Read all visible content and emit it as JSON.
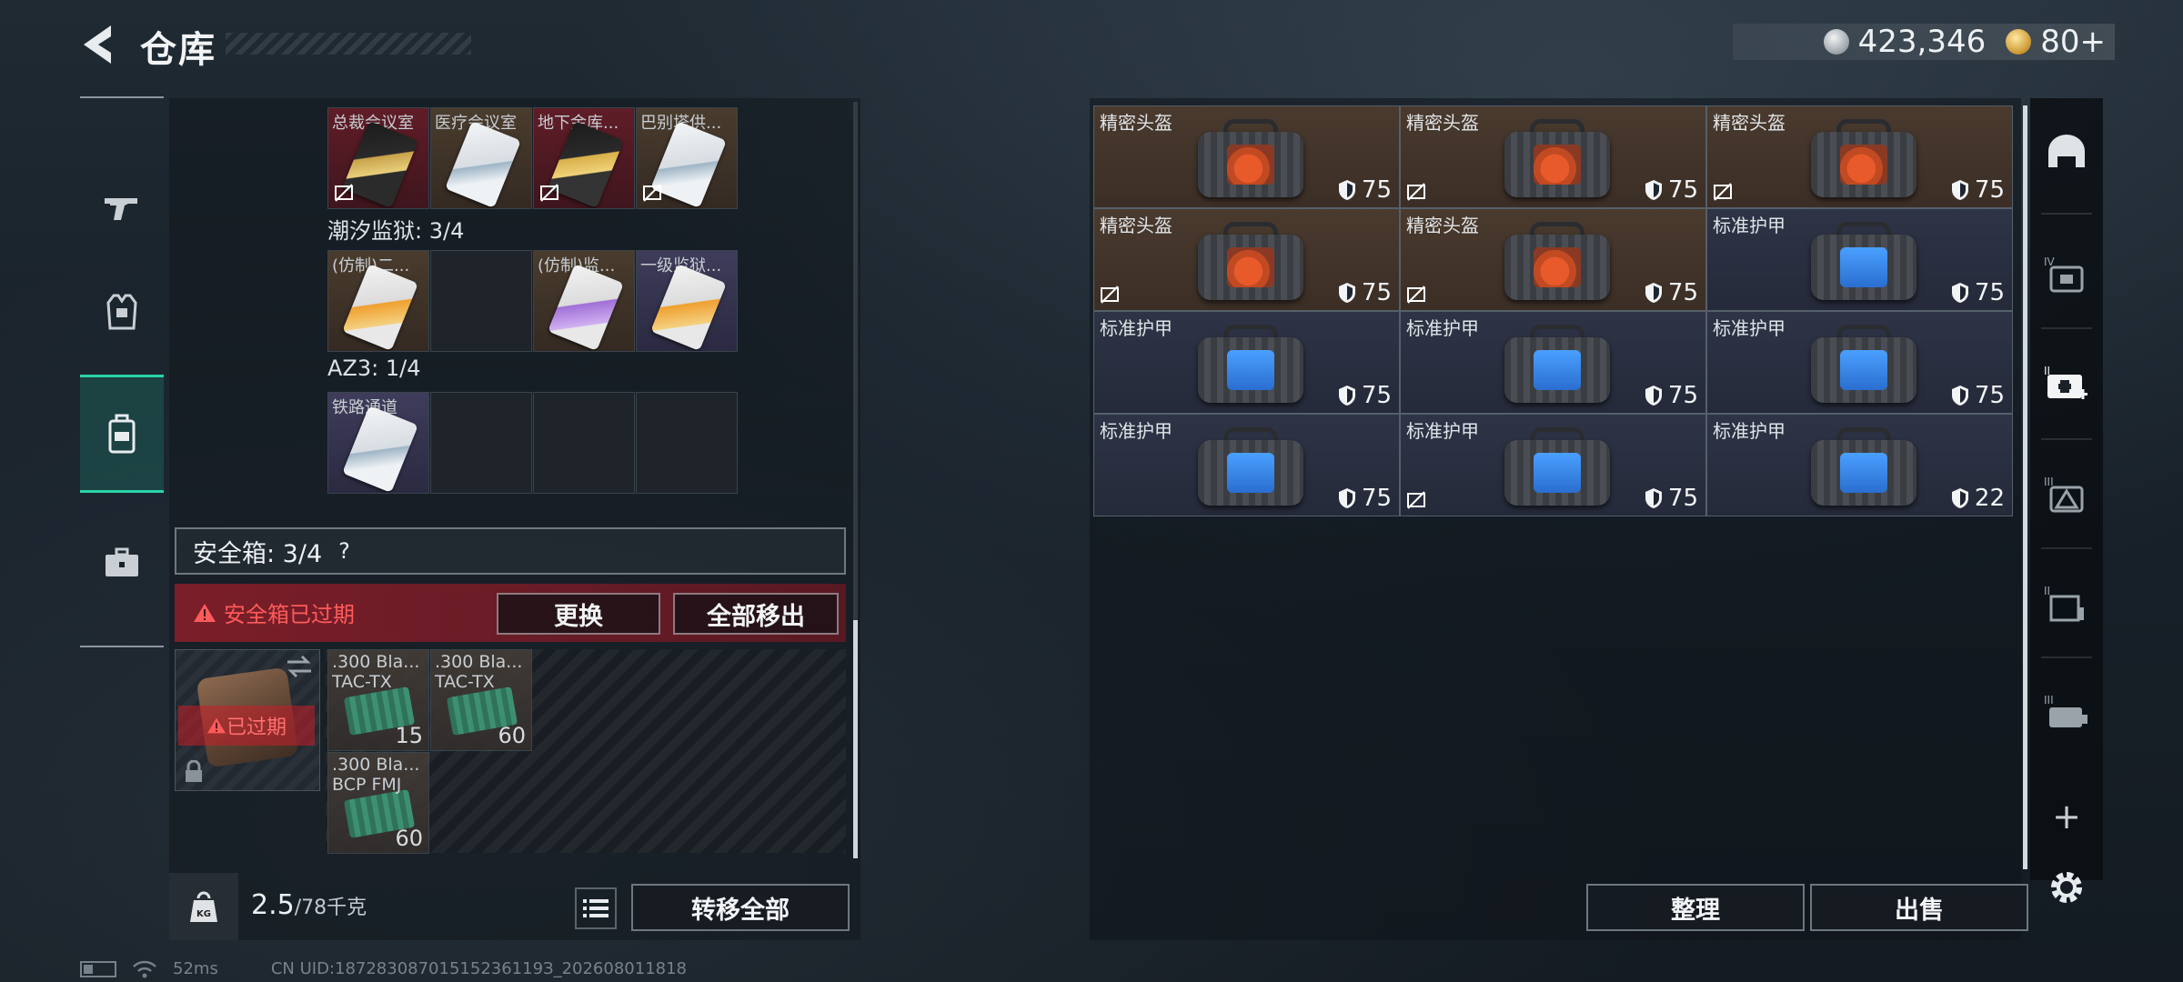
{
  "header": {
    "title": "仓库",
    "currency": [
      {
        "name": "silver-coin",
        "value": "423,346"
      },
      {
        "name": "gold-coin",
        "value": "80+"
      }
    ]
  },
  "left_nav": {
    "items": [
      {
        "icon": "gun-icon",
        "active": false
      },
      {
        "icon": "armor-vest-icon",
        "active": false
      },
      {
        "icon": "backpack-icon",
        "active": true
      },
      {
        "icon": "briefcase-icon",
        "active": false
      }
    ]
  },
  "keycards": {
    "row1": [
      {
        "label": "总裁会议室",
        "color": "red",
        "card": "gold",
        "unusable": true
      },
      {
        "label": "医疗会议室",
        "color": "brown",
        "card": "white",
        "unusable": false
      },
      {
        "label": "地下金库...",
        "color": "red",
        "card": "gold2",
        "unusable": true
      },
      {
        "label": "巴别塔供...",
        "color": "brown",
        "card": "white",
        "unusable": true
      }
    ],
    "section2": "潮汐监狱: 3/4",
    "row2": [
      {
        "label": "(仿制)二...",
        "color": "brown",
        "card": "orange"
      },
      {
        "label": "",
        "color": "empty",
        "card": ""
      },
      {
        "label": "(仿制)监...",
        "color": "brown",
        "card": "violet"
      },
      {
        "label": "一级监狱...",
        "color": "purple",
        "card": "orange"
      }
    ],
    "section3": "AZ3: 1/4",
    "row3": [
      {
        "label": "铁路通道",
        "color": "purple",
        "card": "white"
      },
      {
        "label": "",
        "color": "empty",
        "card": ""
      },
      {
        "label": "",
        "color": "empty",
        "card": ""
      },
      {
        "label": "",
        "color": "empty",
        "card": ""
      }
    ]
  },
  "safe_box": {
    "title": "安全箱: 3/4",
    "help": "?",
    "expired_notice": "安全箱已过期",
    "replace_button": "更换",
    "remove_all_button": "全部移出",
    "expired_tag": "已过期",
    "ammo": [
      {
        "line1": ".300 Bla...",
        "line2": "TAC-TX",
        "count": "15"
      },
      {
        "line1": ".300 Bla...",
        "line2": "TAC-TX",
        "count": "60"
      },
      {
        "line1": ".300 Bla...",
        "line2": "BCP FMJ",
        "count": "60"
      }
    ]
  },
  "footer_left": {
    "weight_unit_icon": "KG",
    "weight_current": "2.5",
    "weight_max": "/78千克",
    "transfer_all_button": "转移全部"
  },
  "status": {
    "ping": "52ms",
    "uid": "CN UID:18728308701515236119З_202608011818"
  },
  "storage": {
    "items": [
      {
        "name": "精密头盔",
        "type": "helmet",
        "durability": "75",
        "unusable": false
      },
      {
        "name": "精密头盔",
        "type": "helmet",
        "durability": "75",
        "unusable": true
      },
      {
        "name": "精密头盔",
        "type": "helmet",
        "durability": "75",
        "unusable": true
      },
      {
        "name": "精密头盔",
        "type": "helmet",
        "durability": "75",
        "unusable": true
      },
      {
        "name": "精密头盔",
        "type": "helmet",
        "durability": "75",
        "unusable": true
      },
      {
        "name": "标准护甲",
        "type": "armor",
        "durability": "75",
        "unusable": false
      },
      {
        "name": "标准护甲",
        "type": "armor",
        "durability": "75",
        "unusable": false
      },
      {
        "name": "标准护甲",
        "type": "armor",
        "durability": "75",
        "unusable": false
      },
      {
        "name": "标准护甲",
        "type": "armor",
        "durability": "75",
        "unusable": false
      },
      {
        "name": "标准护甲",
        "type": "armor",
        "durability": "75",
        "unusable": false
      },
      {
        "name": "标准护甲",
        "type": "armor",
        "durability": "75",
        "unusable": true
      },
      {
        "name": "标准护甲",
        "type": "armor",
        "durability": "22",
        "unusable": false
      }
    ],
    "sort_button": "整理",
    "sell_button": "出售"
  },
  "right_nav": {
    "items": [
      "helmet-tab-icon",
      "armor-iv-icon",
      "medkit-ii-icon",
      "armor-iii-icon",
      "rig-ii-icon",
      "backpack-iii-icon"
    ],
    "add": "+"
  },
  "colors": {
    "accent": "#2bd3a8",
    "danger": "#ff5a5a",
    "helmet_bg": "#4a3a2e",
    "armor_bg": "#2e3446"
  }
}
